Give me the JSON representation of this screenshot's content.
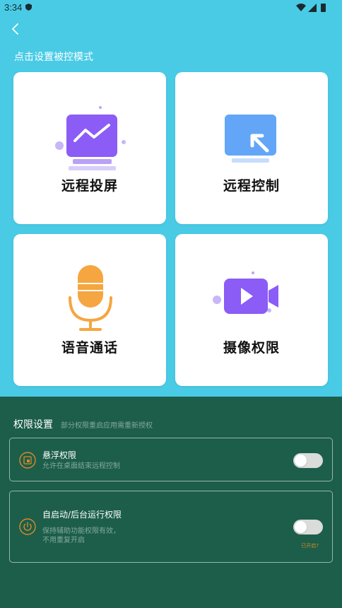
{
  "status_bar": {
    "time": "3:34"
  },
  "header": {
    "title": "点击设置被控模式"
  },
  "modes": [
    {
      "label": "远程投屏",
      "icon": "screen-cast-icon"
    },
    {
      "label": "远程控制",
      "icon": "remote-control-icon"
    },
    {
      "label": "语音通话",
      "icon": "microphone-icon"
    },
    {
      "label": "摄像权限",
      "icon": "video-camera-icon"
    }
  ],
  "permissions": {
    "title": "权限设置",
    "hint": "部分权限重启应用需重新授权",
    "items": [
      {
        "label": "悬浮权限",
        "desc": "允许在桌面结束远程控制",
        "icon": "floating-window-icon",
        "enabled": false
      },
      {
        "label": "自启动/后台运行权限",
        "desc_line1": "保持辅助功能权限有效，",
        "desc_line2": "不用重复开启",
        "icon": "power-icon",
        "enabled": false,
        "status": "已开启?"
      }
    ]
  },
  "colors": {
    "top_bg": "#49cbe6",
    "bottom_bg": "#1c5e4a",
    "accent_orange": "#f5a640",
    "icon_purple": "#8b5cf6"
  }
}
